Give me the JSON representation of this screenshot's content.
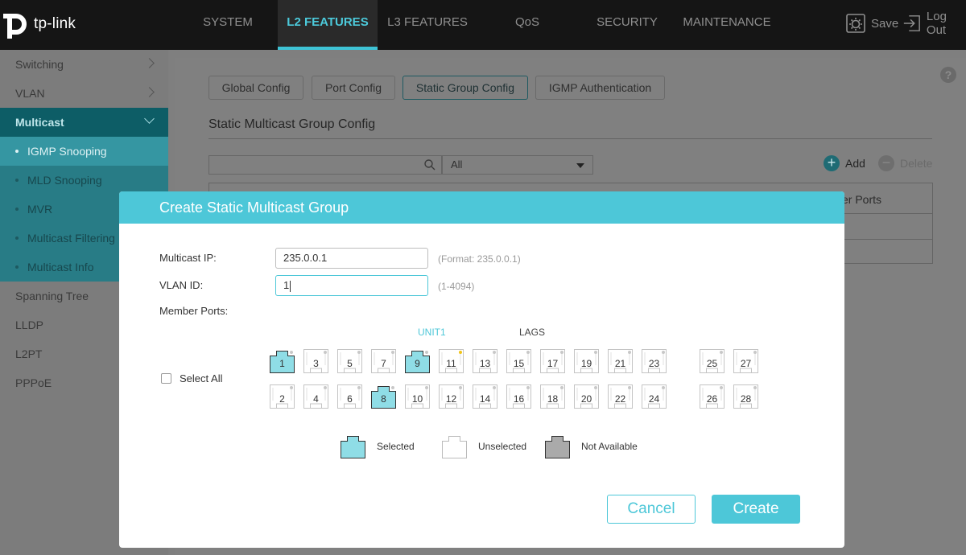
{
  "brand": {
    "logo_text": "tp-link",
    "accent": "#4dc7d8",
    "selected_port_fill": "#8fdde6",
    "unavailable_port_fill": "#aaaaaa"
  },
  "nav": {
    "items": [
      {
        "label": "SYSTEM"
      },
      {
        "label": "L2 FEATURES",
        "active": true
      },
      {
        "label": "L3 FEATURES"
      },
      {
        "label": "QoS"
      },
      {
        "label": "SECURITY"
      },
      {
        "label": "MAINTENANCE"
      }
    ],
    "save_label": "Save",
    "save_icon": "save-gear-icon",
    "logout_label": "Log Out",
    "logout_icon": "logout-icon"
  },
  "sidebar": {
    "items": [
      {
        "label": "Switching",
        "has_chevron": true
      },
      {
        "label": "VLAN",
        "has_chevron": true
      },
      {
        "label": "Multicast",
        "has_chevron": true,
        "open": true
      }
    ],
    "subitems": [
      {
        "label": "IGMP Snooping",
        "active": true
      },
      {
        "label": "MLD Snooping"
      },
      {
        "label": "MVR"
      },
      {
        "label": "Multicast Filtering"
      },
      {
        "label": "Multicast Info"
      }
    ],
    "more_items": [
      {
        "label": "Spanning Tree"
      },
      {
        "label": "LLDP"
      },
      {
        "label": "L2PT"
      },
      {
        "label": "PPPoE"
      }
    ]
  },
  "page": {
    "tabs": [
      {
        "label": "Global Config"
      },
      {
        "label": "Port Config"
      },
      {
        "label": "Static Group Config",
        "active": true
      },
      {
        "label": "IGMP Authentication"
      }
    ],
    "section_title": "Static Multicast Group Config",
    "filter_value": "All",
    "add_label": "Add",
    "delete_label": "Delete",
    "table_header_fragment": "er Ports",
    "help_glyph": "?"
  },
  "modal": {
    "title": "Create Static Multicast Group",
    "multicast_ip_label": "Multicast IP:",
    "multicast_ip_value": "235.0.0.1",
    "multicast_ip_hint": "(Format: 235.0.0.1)",
    "vlan_id_label": "VLAN ID:",
    "vlan_id_value": "1",
    "vlan_id_hint": "(1-4094)",
    "member_ports_label": "Member Ports:",
    "unit_label": "UNIT1",
    "lags_label": "LAGS",
    "select_all_label": "Select All",
    "ports_top": [
      {
        "num": "1",
        "selected": true
      },
      {
        "num": "3"
      },
      {
        "num": "5"
      },
      {
        "num": "7"
      },
      {
        "num": "9",
        "selected": true
      },
      {
        "num": "11",
        "led": "yellow"
      },
      {
        "num": "13"
      },
      {
        "num": "15"
      },
      {
        "num": "17"
      },
      {
        "num": "19"
      },
      {
        "num": "21"
      },
      {
        "num": "23"
      },
      {
        "num": "25"
      },
      {
        "num": "27"
      }
    ],
    "ports_bottom": [
      {
        "num": "2"
      },
      {
        "num": "4"
      },
      {
        "num": "6"
      },
      {
        "num": "8",
        "selected": true
      },
      {
        "num": "10"
      },
      {
        "num": "12"
      },
      {
        "num": "14"
      },
      {
        "num": "16"
      },
      {
        "num": "18"
      },
      {
        "num": "20"
      },
      {
        "num": "22"
      },
      {
        "num": "24"
      },
      {
        "num": "26"
      },
      {
        "num": "28"
      }
    ],
    "legend": {
      "selected": "Selected",
      "unselected": "Unselected",
      "not_available": "Not Available"
    },
    "cancel_label": "Cancel",
    "create_label": "Create"
  }
}
